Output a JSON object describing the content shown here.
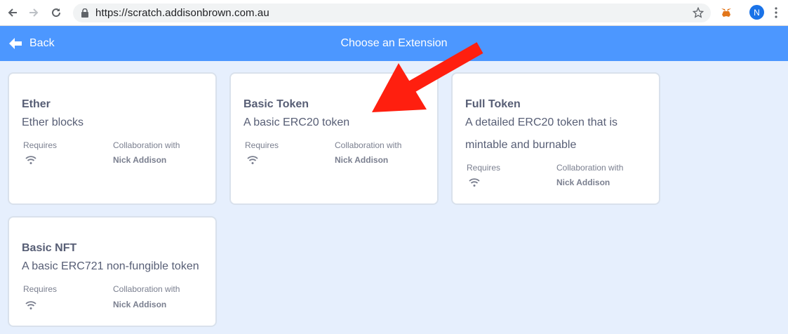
{
  "browser": {
    "url": "https://scratch.addisonbrown.com.au",
    "avatar_initial": "N"
  },
  "header": {
    "back_label": "Back",
    "title": "Choose an Extension"
  },
  "extensions": [
    {
      "title": "Ether",
      "description": "Ether blocks",
      "requires_label": "Requires",
      "collab_label": "Collaboration with",
      "collaborator": "Nick Addison"
    },
    {
      "title": "Basic Token",
      "description": "A basic ERC20 token",
      "requires_label": "Requires",
      "collab_label": "Collaboration with",
      "collaborator": "Nick Addison"
    },
    {
      "title": "Full Token",
      "description": "A detailed ERC20 token that is mintable and burnable",
      "requires_label": "Requires",
      "collab_label": "Collaboration with",
      "collaborator": "Nick Addison"
    },
    {
      "title": "Basic NFT",
      "description": "A basic ERC721 non-fungible token",
      "requires_label": "Requires",
      "collab_label": "Collaboration with",
      "collaborator": "Nick Addison"
    }
  ],
  "colors": {
    "header": "#4c97ff",
    "background": "#e6effd",
    "annotation_arrow": "#ff1f0f"
  },
  "icons": {
    "back": "arrow-left-icon",
    "requires": "wifi-icon"
  }
}
